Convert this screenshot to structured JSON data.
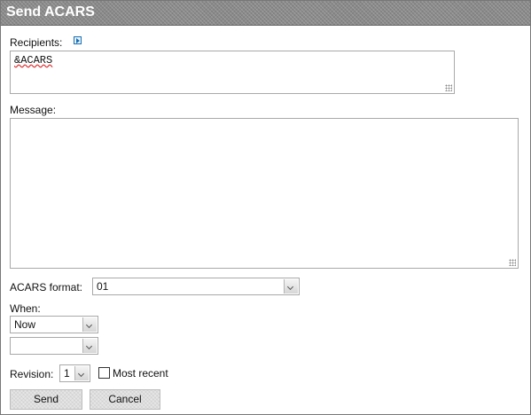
{
  "dialog": {
    "title": "Send ACARS"
  },
  "recipients": {
    "label": "Recipients:",
    "expand_icon": "expand-icon",
    "value": "&ACARS"
  },
  "message": {
    "label": "Message:",
    "value": ""
  },
  "acars_format": {
    "label": "ACARS format:",
    "selected": "01"
  },
  "when": {
    "label": "When:",
    "selected": "Now",
    "secondary_selected": ""
  },
  "revision": {
    "label": "Revision:",
    "selected": "1",
    "most_recent_label": "Most recent",
    "most_recent_checked": false
  },
  "buttons": {
    "send": "Send",
    "cancel": "Cancel"
  },
  "colors": {
    "title_bar": "#8a8a8a",
    "field_border": "#a9a9a9",
    "spellcheck_underline": "#d33"
  }
}
